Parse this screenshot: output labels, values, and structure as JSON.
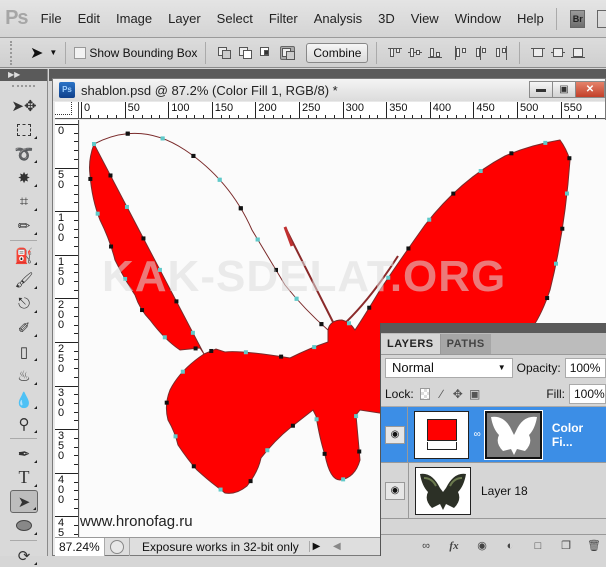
{
  "app": {
    "logo": "Ps",
    "menu": [
      "File",
      "Edit",
      "Image",
      "Layer",
      "Select",
      "Filter",
      "Analysis",
      "3D",
      "View",
      "Window",
      "Help"
    ],
    "bridge_button": "Br"
  },
  "options_bar": {
    "tool_icon": "path-selection-arrow-icon",
    "show_bounding_box_label": "Show Bounding Box",
    "show_bounding_box_checked": false,
    "path_ops": [
      "add-to-shape-area-icon",
      "subtract-from-shape-area-icon",
      "intersect-shape-areas-icon",
      "exclude-overlapping-shape-areas-icon"
    ],
    "combine_label": "Combine",
    "align_icons": [
      "align-top-edges-icon",
      "align-vertical-centers-icon",
      "align-bottom-edges-icon",
      "align-left-edges-icon",
      "align-horizontal-centers-icon",
      "align-right-edges-icon",
      "distribute-top-edges-icon",
      "distribute-vertical-centers-icon",
      "distribute-bottom-edges-icon"
    ]
  },
  "tools": [
    "move",
    "rectangular-marquee",
    "lasso",
    "magic-wand",
    "crop",
    "eyedropper",
    "spot-healing-brush",
    "brush",
    "clone-stamp",
    "history-brush",
    "eraser",
    "paint-bucket",
    "blur",
    "dodge",
    "pen",
    "type",
    "path-selection",
    "ellipse",
    "3d-rotate"
  ],
  "document": {
    "title": "shablon.psd @ 87.2% (Color Fill 1, RGB/8) *",
    "ruler_h_labels": [
      "0",
      "50",
      "100",
      "150",
      "200",
      "250",
      "300",
      "350",
      "400",
      "450",
      "500",
      "550"
    ],
    "ruler_v_labels": [
      "0",
      "50",
      "100",
      "150",
      "200",
      "250",
      "300",
      "350",
      "400",
      "450"
    ],
    "watermark": "KAK-SDELAT.ORG",
    "site_credit": "www.hronofag.ru",
    "fill_color": "#ff0000"
  },
  "status": {
    "zoom": "87.24%",
    "info": "Exposure works in 32-bit only"
  },
  "layers_panel": {
    "tabs": [
      "LAYERS",
      "PATHS"
    ],
    "active_tab": "LAYERS",
    "blend_mode": "Normal",
    "opacity_label": "Opacity:",
    "opacity": "100%",
    "lock_label": "Lock:",
    "fill_label": "Fill:",
    "fill": "100%",
    "layers": [
      {
        "name": "Color Fi...",
        "selected": true,
        "visible": true
      },
      {
        "name": "Layer 18",
        "selected": false,
        "visible": true
      }
    ],
    "footer_icons": [
      "link-layers-icon",
      "fx-icon",
      "add-mask-icon",
      "adjustment-layer-icon",
      "new-group-icon",
      "new-layer-icon",
      "delete-layer-icon"
    ]
  }
}
